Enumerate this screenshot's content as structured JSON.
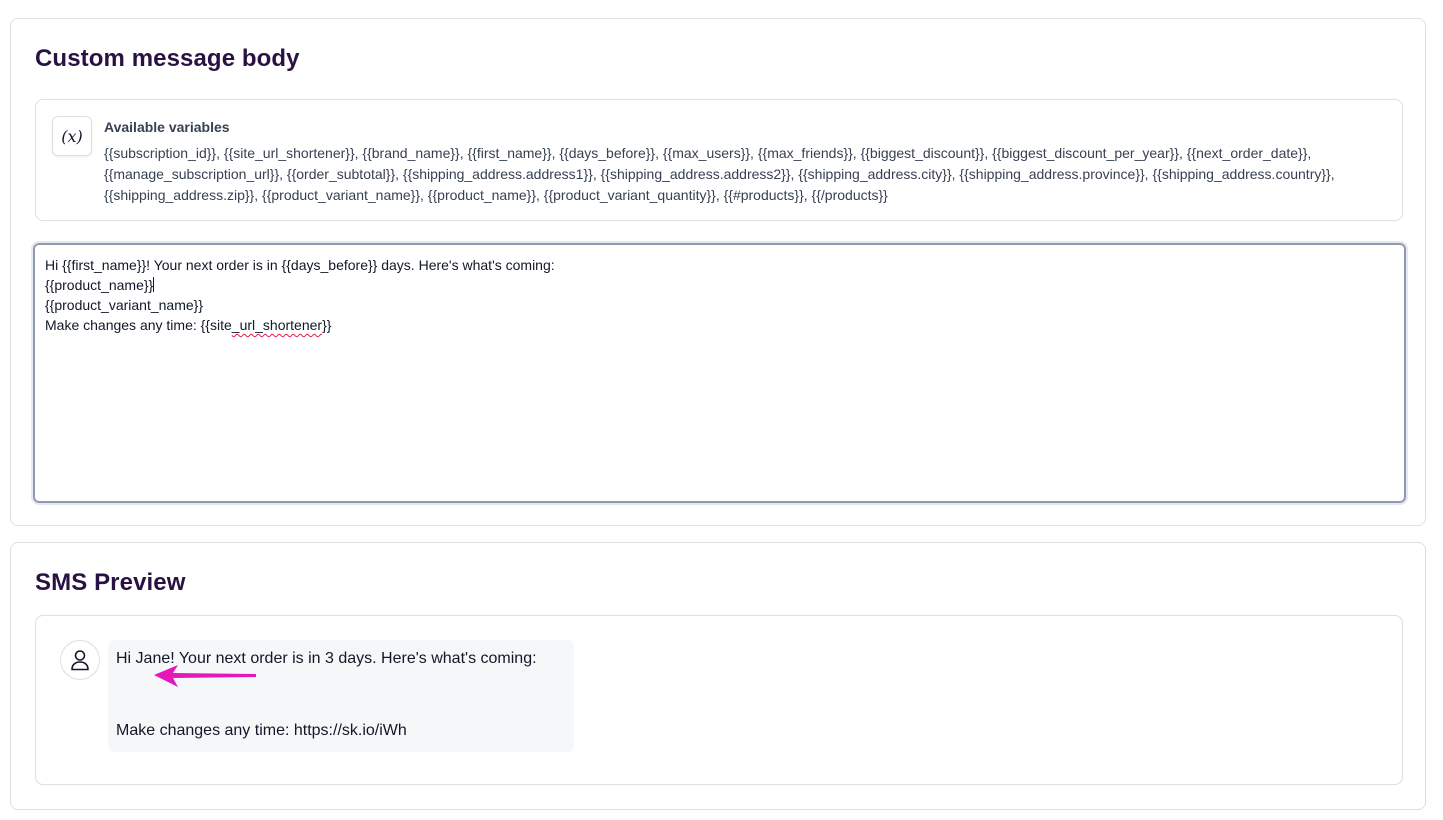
{
  "body_section": {
    "title": "Custom message body",
    "variables": {
      "icon": "variable-icon",
      "icon_glyph": "(x)",
      "label": "Available variables",
      "list": "{{subscription_id}}, {{site_url_shortener}}, {{brand_name}}, {{first_name}}, {{days_before}}, {{max_users}}, {{max_friends}}, {{biggest_discount}}, {{biggest_discount_per_year}}, {{next_order_date}}, {{manage_subscription_url}}, {{order_subtotal}}, {{shipping_address.address1}}, {{shipping_address.address2}}, {{shipping_address.city}}, {{shipping_address.province}}, {{shipping_address.country}}, {{shipping_address.zip}}, {{product_variant_name}}, {{product_name}}, {{product_variant_quantity}}, {{#products}}, {{/products}}"
    },
    "editor": {
      "line1": "Hi {{first_name}}! Your next order is in {{days_before}} days. Here's what's coming:",
      "line2": "{{product_name}}",
      "line3": "{{product_variant_name}}",
      "line4_prefix": "Make changes any time: {{site",
      "line4_squiggle": "_url_shortener",
      "line4_suffix": "}}"
    }
  },
  "preview_section": {
    "title": "SMS Preview",
    "avatar_icon": "user-icon",
    "message_line1": "Hi Jane! Your next order is in 3 days. Here's what's coming:",
    "message_line2": "Make changes any time: https://sk.io/iWh",
    "annotation_arrow_color": "#e617b8"
  },
  "colors": {
    "title": "#2a1143",
    "border": "#dcdfe4",
    "editor_border": "#8e9ab0",
    "bubble_bg": "#f6f7f9"
  }
}
